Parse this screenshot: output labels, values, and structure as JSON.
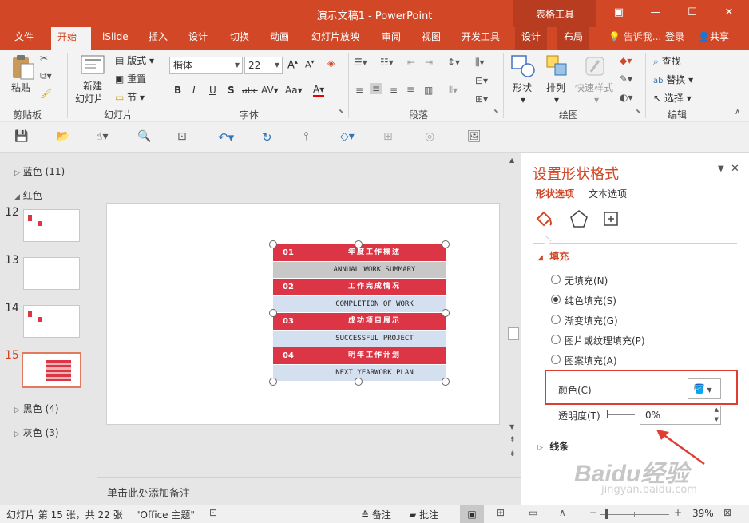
{
  "window": {
    "title": "演示文稿1 - PowerPoint",
    "context_tab_group": "表格工具"
  },
  "tabs": [
    "文件",
    "开始",
    "iSlide",
    "插入",
    "设计",
    "切换",
    "动画",
    "幻灯片放映",
    "审阅",
    "视图",
    "开发工具",
    "设计",
    "布局"
  ],
  "tell_me": "告诉我...",
  "sign_in": "登录",
  "share": "共享",
  "ribbon": {
    "clipboard": {
      "label": "剪贴板",
      "paste": "粘贴"
    },
    "slides": {
      "label": "幻灯片",
      "new_slide_1": "新建",
      "new_slide_2": "幻灯片",
      "layout": "版式",
      "reset": "重置",
      "section": "节"
    },
    "font": {
      "label": "字体",
      "font_name": "楷体",
      "font_size": "22",
      "b": "B",
      "i": "I",
      "u": "U",
      "s": "S",
      "abc": "abc",
      "av": "AV",
      "aa": "Aa",
      "a": "A"
    },
    "paragraph": {
      "label": "段落"
    },
    "drawing": {
      "label": "绘图",
      "shape": "形状",
      "arrange": "排列",
      "quick_style": "快速样式"
    },
    "editing": {
      "label": "编辑",
      "find": "查找",
      "replace": "替换",
      "select": "选择"
    }
  },
  "thumbnails": {
    "sections": [
      {
        "name": "蓝色 (11)"
      },
      {
        "name": "红色"
      },
      {
        "name": "黑色 (4)"
      },
      {
        "name": "灰色 (3)"
      }
    ],
    "slides": [
      {
        "num": "12"
      },
      {
        "num": "13"
      },
      {
        "num": "14"
      },
      {
        "num": "15"
      }
    ]
  },
  "slide_table": {
    "rows": [
      {
        "num": "01",
        "text": "年度工作概述",
        "style": "red"
      },
      {
        "num": "",
        "text": "ANNUAL WORK SUMMARY",
        "style": "gray"
      },
      {
        "num": "02",
        "text": "工作完成情况",
        "style": "red"
      },
      {
        "num": "",
        "text": "COMPLETION OF WORK",
        "style": "light"
      },
      {
        "num": "03",
        "text": "成功项目展示",
        "style": "red"
      },
      {
        "num": "",
        "text": "SUCCESSFUL PROJECT",
        "style": "light"
      },
      {
        "num": "04",
        "text": "明年工作计划",
        "style": "red"
      },
      {
        "num": "",
        "text": "NEXT YEARWORK PLAN",
        "style": "light"
      }
    ]
  },
  "notes_placeholder": "单击此处添加备注",
  "format_pane": {
    "title": "设置形状格式",
    "tab_shape": "形状选项",
    "tab_text": "文本选项",
    "fill_section": "填充",
    "no_fill": "无填充(N)",
    "solid_fill": "纯色填充(S)",
    "gradient_fill": "渐变填充(G)",
    "picture_fill": "图片或纹理填充(P)",
    "pattern_fill": "图案填充(A)",
    "color_label": "颜色(C)",
    "transparency_label": "透明度(T)",
    "transparency_value": "0%",
    "line_section": "线条"
  },
  "status": {
    "slide_info": "幻灯片 第 15 张，共 22 张",
    "theme": "\"Office 主题\"",
    "notes": "备注",
    "comments": "批注",
    "zoom": "39%"
  },
  "watermark": {
    "brand": "Baidu经验",
    "url": "jingyan.baidu.com"
  },
  "colors": {
    "accent": "#d24726",
    "table_red": "#dc3545",
    "table_gray": "#c8c8c8",
    "table_light": "#d4dff0",
    "highlight_box": "#e03c31"
  }
}
